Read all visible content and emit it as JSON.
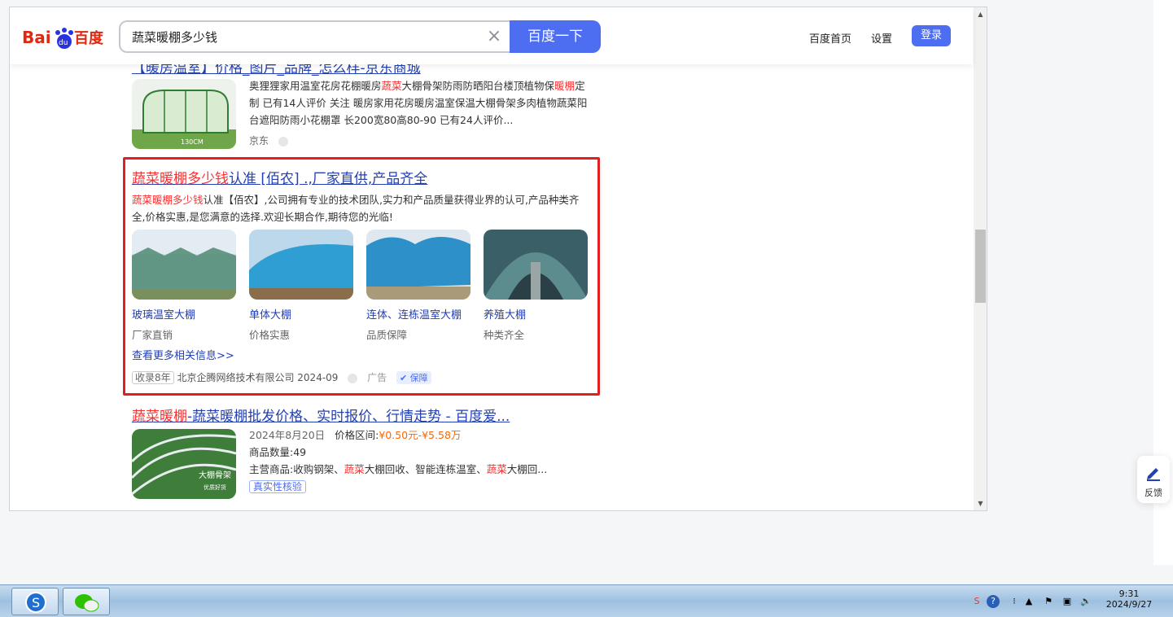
{
  "search": {
    "query": "蔬菜暖棚多少钱",
    "button_label": "百度一下"
  },
  "header": {
    "home_link": "百度首页",
    "settings_link": "设置",
    "login_label": "登录"
  },
  "results": {
    "partial_title": "【暖房温室】价格_图片_品牌_怎么样-京东商城",
    "item1": {
      "snippet_a": "奥狸狸家用温室花房花棚暖房",
      "snippet_em1": "蔬菜",
      "snippet_b": "大棚骨架防雨防晒阳台楼顶植物保",
      "snippet_em2": "暖棚",
      "snippet_c": "定制 已有14人评价 关注 暖房家用花房暖房温室保温大棚骨架多肉植物蔬菜阳台遮阳防雨小花棚罩 长200宽80高80-90 已有24人评价...",
      "source": "京东",
      "thumb_label": "130CM"
    },
    "ad": {
      "title_em": "蔬菜暖棚多少钱",
      "title_rest": "认准 [佰农] .,厂家直供,产品齐全",
      "desc_em": "蔬菜暖棚多少钱",
      "desc_rest": "认准【佰农】,公司拥有专业的技术团队,实力和产品质量获得业界的认可,产品种类齐全,价格实惠,是您满意的选择.欢迎长期合作,期待您的光临!",
      "cards": [
        {
          "name": "玻璃温室大棚",
          "sub": "厂家直销"
        },
        {
          "name": "单体大棚",
          "sub": "价格实惠"
        },
        {
          "name": "连体、连栋温室大棚",
          "sub": "品质保障"
        },
        {
          "name": "养殖大棚",
          "sub": "种类齐全"
        }
      ],
      "more_link": "查看更多相关信息>>",
      "badge": "收录8年",
      "company": "北京企腾网络技术有限公司 2024-09",
      "ad_label": "广告",
      "guarantee": "保障"
    },
    "item3": {
      "title_em": "蔬菜暖棚",
      "title_rest": "-蔬菜暖棚批发价格、实时报价、行情走势 - 百度爱...",
      "date": "2024年8月20日",
      "price_label": "价格区间:",
      "price_range": "¥0.50元-¥5.58万",
      "count": "商品数量:49",
      "main_a": "主营商品:收购钢架、",
      "main_em1": "蔬菜",
      "main_b": "大棚回收、智能连栋温室、",
      "main_em2": "蔬菜",
      "main_c": "大棚回...",
      "verify": "真实性核验",
      "thumb_label": "大棚骨架",
      "thumb_sub": "优质好货"
    }
  },
  "feedback": {
    "label": "反馈"
  },
  "taskbar": {
    "time": "9:31",
    "date": "2024/9/27"
  }
}
